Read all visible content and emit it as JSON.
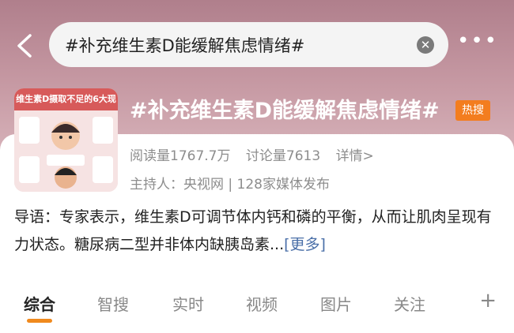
{
  "search": {
    "query": "#补充维生素D能缓解焦虑情绪#"
  },
  "topic": {
    "title": "#补充维生素D能缓解焦虑情绪#",
    "badge": "热搜",
    "reads": "阅读量1767.7万",
    "discussions": "讨论量7613",
    "details_link": "详情>",
    "host": "主持人：央视网 | 128家媒体发布",
    "thumbnail_caption": "维生素D摄取不足的6大现"
  },
  "intro": {
    "text": "导语：专家表示，维生素D可调节体内钙和磷的平衡，从而让肌肉呈现有力状态。糖尿病二型并非体内缺胰岛素...",
    "more": "[更多]"
  },
  "tabs": [
    "综合",
    "智搜",
    "实时",
    "视频",
    "图片",
    "关注"
  ],
  "active_tab": "综合",
  "colors": {
    "accent": "#f08a1e",
    "badge": "#f37d1f",
    "link": "#4a6fa8",
    "header": "#b07f8c"
  },
  "icons": {
    "back": "chevron-left-icon",
    "clear": "clear-icon",
    "more": "more-icon",
    "add": "plus-icon"
  }
}
